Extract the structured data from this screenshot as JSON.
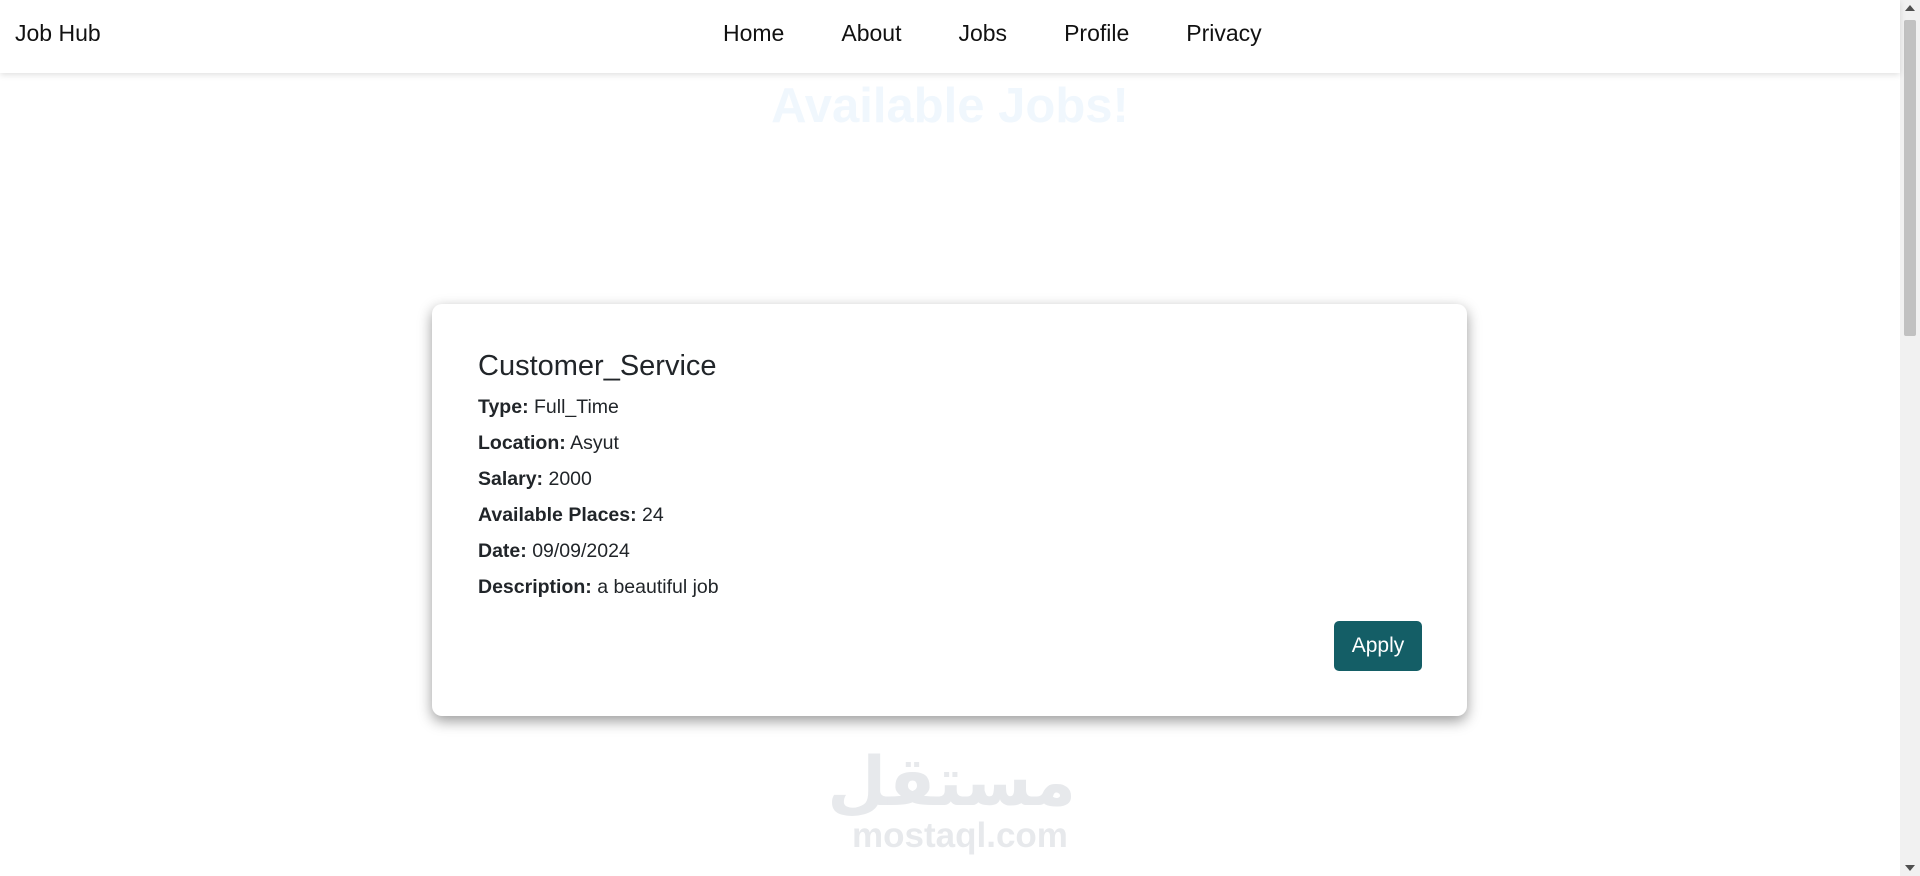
{
  "navbar": {
    "brand": "Job Hub",
    "links": [
      "Home",
      "About",
      "Jobs",
      "Profile",
      "Privacy"
    ]
  },
  "main": {
    "heading": "Available Jobs!",
    "jobs": [
      {
        "title": "Customer_Service",
        "fields": [
          {
            "label": "Type:",
            "value": "Full_Time"
          },
          {
            "label": "Location:",
            "value": "Asyut"
          },
          {
            "label": "Salary:",
            "value": "2000"
          },
          {
            "label": "Available Places:",
            "value": "24"
          },
          {
            "label": "Date:",
            "value": "09/09/2024"
          },
          {
            "label": "Description:",
            "value": "a beautiful job"
          }
        ],
        "apply_label": "Apply"
      }
    ]
  },
  "watermark": {
    "arabic": "مستقل",
    "latin": "mostaql.com"
  },
  "colors": {
    "apply_button": "#145e66",
    "heading": "#f0f7fd",
    "watermark": "#e7e9ec"
  }
}
